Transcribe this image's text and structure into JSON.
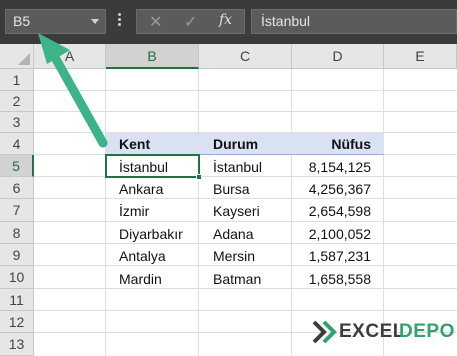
{
  "formula_bar": {
    "name_box": "B5",
    "cancel_glyph": "✕",
    "enter_glyph": "✓",
    "fx_label": "fx",
    "formula_value": "İstanbul"
  },
  "columns": [
    "A",
    "B",
    "C",
    "D",
    "E"
  ],
  "active_column": "B",
  "rows": [
    "1",
    "2",
    "3",
    "4",
    "5",
    "6",
    "7",
    "8",
    "9",
    "10",
    "11",
    "12",
    "13"
  ],
  "active_row": "5",
  "table": {
    "headers": [
      "Kent",
      "Durum",
      "Nüfus"
    ],
    "rows": [
      [
        "İstanbul",
        "İstanbul",
        "8,154,125"
      ],
      [
        "Ankara",
        "Bursa",
        "4,256,367"
      ],
      [
        "İzmir",
        "Kayseri",
        "2,654,598"
      ],
      [
        "Diyarbakır",
        "Adana",
        "2,100,052"
      ],
      [
        "Antalya",
        "Mersin",
        "1,587,231"
      ],
      [
        "Mardin",
        "Batman",
        "1,658,558"
      ]
    ]
  },
  "logo": {
    "part1": "EXCEL",
    "part2": "DEPO"
  },
  "colors": {
    "accent_green": "#217346",
    "arrow": "#3cb488",
    "table_header_fill": "#d9e1f2",
    "logo_green": "#2fa36b"
  },
  "icons": [
    "dropdown-chevron-icon",
    "kebab-icon",
    "cancel-icon",
    "enter-icon",
    "function-icon",
    "arrow-pointer",
    "excel-depo-logo"
  ]
}
